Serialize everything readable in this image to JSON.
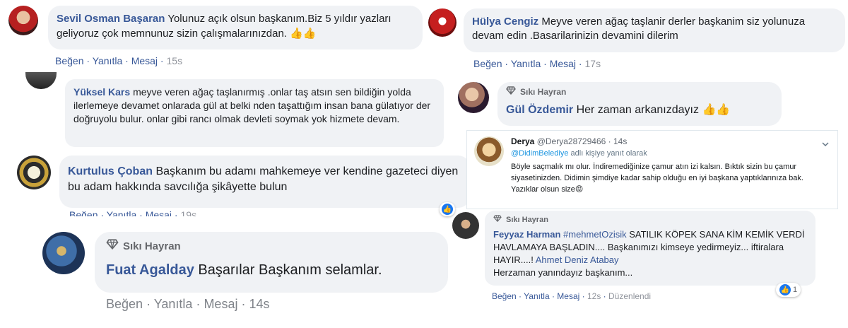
{
  "c1": {
    "name": "Sevil Osman Başaran",
    "text": "Yolunuz açık olsun başkanım.Biz 5 yıldır yazları geliyoruz çok memnunuz sizin çalışmalarınızdan.",
    "emoji": "👍👍",
    "like": "Beğen",
    "reply": "Yanıtla",
    "message": "Mesaj",
    "time": "15s"
  },
  "c2": {
    "name": "Hülya Cengiz",
    "text": "Meyve veren ağaç taşlanir derler başkanim siz yolunuza devam edin .Basarilarinizin devamini dilerim",
    "like": "Beğen",
    "reply": "Yanıtla",
    "message": "Mesaj",
    "time": "17s"
  },
  "c3": {
    "name": "Yüksel Kars",
    "text": "meyve veren ağaç taşlanırmış .onlar taş atsın sen bildiğin yolda ilerlemeye devamet onlarada gül at belki nden taşattığım insan bana gülatıyor der doğruyolu bulur. onlar gibi rancı olmak devleti soymak yok hizmete devam."
  },
  "c4": {
    "badge": "Sıkı Hayran",
    "name": "Gül Özdemir",
    "text": "Her zaman arkanızdayız",
    "emoji": "👍👍"
  },
  "c5": {
    "name": "Kurtulus Çoban",
    "text": "Başkanım bu adamı mahkemeye ver kendine gazeteci diyen bu adam hakkında savcılığa şikâyette bulun",
    "like": "Beğen",
    "reply": "Yanıtla",
    "message": "Mesaj",
    "time": "19s"
  },
  "c6": {
    "name": "Derya",
    "handle": "@Derya28729466",
    "time": "14s",
    "reply_to_mention": "@DidimBelediye",
    "reply_to_suffix": "adlı kişiye yanıt olarak",
    "text": "Böyle saçmalık mı olur. İndiremediğinize çamur atın izi kalsın. Bıktık sizin bu çamur siyasetinizden. Didimin şimdiye kadar sahip olduğu en iyi başkana yaptıklarınıza bak. Yazıklar olsun size",
    "emoji": "😡"
  },
  "c7": {
    "badge": "Sıkı Hayran",
    "name": "Fuat Agalday",
    "text": "Başarılar Başkanım selamlar.",
    "like": "Beğen",
    "reply": "Yanıtla",
    "message": "Mesaj",
    "time": "14s"
  },
  "c8": {
    "badge": "Sıkı Hayran",
    "name": "Feyyaz Harman",
    "mention": "#mehmetOzisik",
    "text": "SATILIK KÖPEK SANA KİM KEMİK VERDİ HAVLAMAYA BAŞLADIN.... Başkanımızı kimseye yedirmeyiz... iftiralara HAYIR....!",
    "mention2": "Ahmet Deniz Atabay",
    "text2": "Herzaman yanındayız başkanım...",
    "like": "Beğen",
    "reply": "Yanıtla",
    "message": "Mesaj",
    "time": "12s",
    "edited": "Düzenlendi",
    "reactions": "1"
  },
  "colors": {
    "link": "#385898",
    "bubble": "#f0f2f5",
    "like": "#1877f2"
  },
  "icons": [
    "diamond-icon",
    "like-icon",
    "chevron-down-icon"
  ]
}
